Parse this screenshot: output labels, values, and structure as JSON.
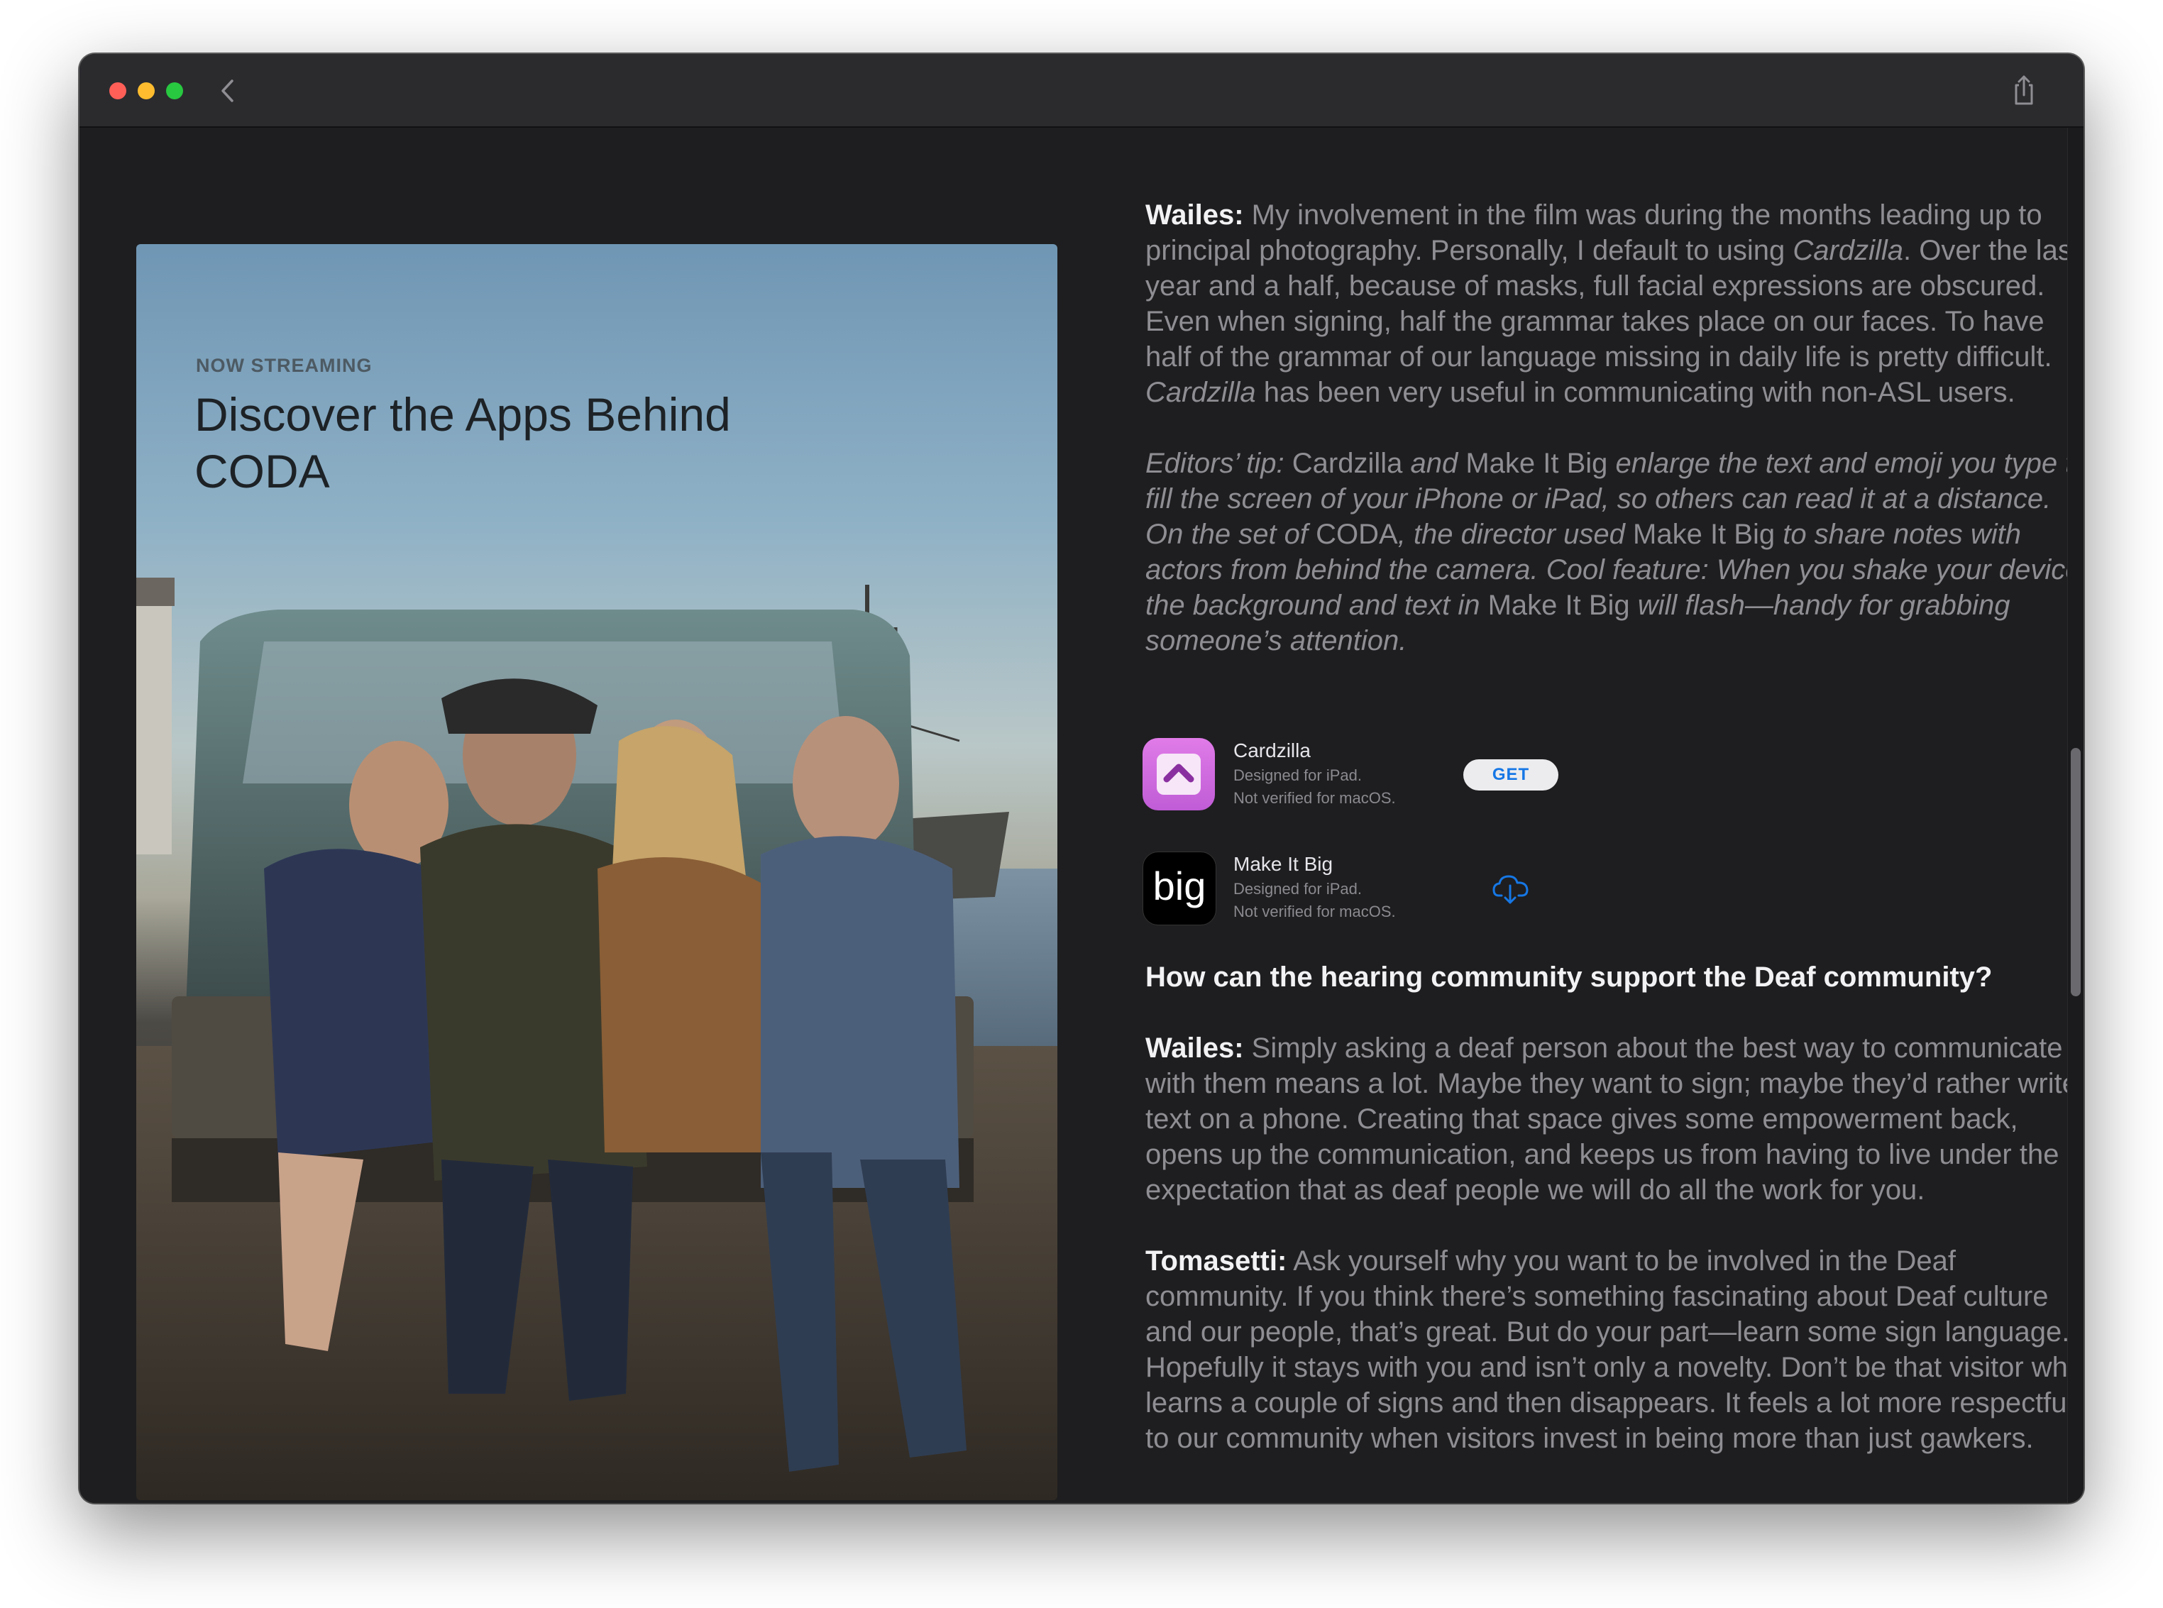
{
  "toolbar": {
    "back_icon": "chevron-left-icon",
    "share_icon": "share-icon"
  },
  "hero": {
    "eyebrow": "NOW STREAMING",
    "title": "Discover the Apps Behind CODA"
  },
  "article": {
    "p1": {
      "speaker": "Wailes:",
      "t1": " My involvement in the film was during the months leading up to principal photography. Personally, I default to using ",
      "app1": "Cardzilla",
      "t2": ". Over the last year and a half, because of masks, full facial expressions are obscured. Even when signing, half the grammar takes place on our faces. To have half of the grammar of our language missing in daily life is pretty difficult. ",
      "app2": "Cardzilla",
      "t3": " has been very useful in communicating with non-ASL users."
    },
    "tip": {
      "t1": "Editors’ tip: ",
      "app1": "Cardzilla",
      "t2": " and ",
      "app2": "Make It Big",
      "t3": " enlarge the text and emoji you type to fill the screen of your iPhone or iPad, so others can read it at a distance. On the set of ",
      "film": "CODA",
      "t4": ", the director used ",
      "app3": "Make It Big",
      "t5": " to share notes with actors from behind the camera. Cool feature: When you shake your device, the background and text in ",
      "app4": "Make It Big",
      "t6": " will flash—handy for grabbing someone’s attention."
    },
    "question": "How can the hearing community support the Deaf community?",
    "p2": {
      "speaker": "Wailes:",
      "text": " Simply asking a deaf person about the best way to communicate with them means a lot. Maybe they want to sign; maybe they’d rather write text on a phone. Creating that space gives some empowerment back, opens up the communication, and keeps us from having to live under the expectation that as deaf people we will do all the work for you."
    },
    "p3": {
      "speaker": "Tomasetti:",
      "text": " Ask yourself why you want to be involved in the Deaf community. If you think there’s something fascinating about Deaf culture and our people, that’s great. But do your part—learn some sign language. Hopefully it stays with you and isn’t only a novelty. Don’t be that visitor who learns a couple of signs and then disappears. It feels a lot more respectful to our community when visitors invest in being more than just gawkers."
    }
  },
  "apps": [
    {
      "name": "Cardzilla",
      "line1": "Designed for iPad.",
      "line2": "Not verified for macOS.",
      "action": "GET",
      "icon": "cardzilla-app-icon"
    },
    {
      "name": "Make It Big",
      "line1": "Designed for iPad.",
      "line2": "Not verified for macOS.",
      "action_icon": "cloud-download-icon",
      "icon_text": "big",
      "icon": "make-it-big-app-icon"
    }
  ],
  "colors": {
    "window_bg": "#1e1e20",
    "titlebar": "#2b2b2e",
    "accent": "#1677e5",
    "body_text": "#8e8e93",
    "heading_text": "#f2f2f5"
  }
}
